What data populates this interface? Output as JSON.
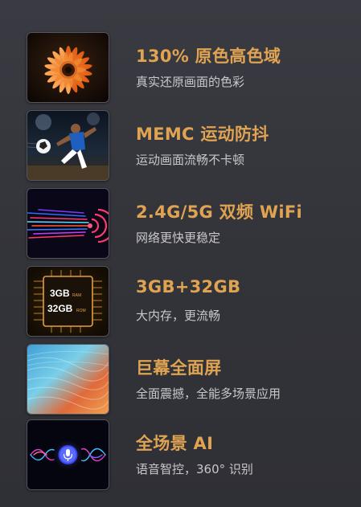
{
  "features": [
    {
      "title": "130% 原色高色域",
      "subtitle": "真实还原画面的色彩",
      "image": "orange-gerbera-flower-photo"
    },
    {
      "title": "MEMC 运动防抖",
      "subtitle": "运动画面流畅不卡顿",
      "image": "soccer-player-kicking-ball-photo"
    },
    {
      "title": "2.4G/5G 双频 WiFi",
      "subtitle": "网络更快更稳定",
      "image": "wifi-signal-light-streaks"
    },
    {
      "title": "3GB+32GB",
      "subtitle": "大内存，更流畅",
      "image": "memory-chip-icon",
      "chip_line1": "3GB",
      "chip_line1_tag": "RAM",
      "chip_line2": "32GB",
      "chip_line2_tag": "ROM"
    },
    {
      "title": "巨幕全面屏",
      "subtitle": "全面震撼，全能多场景应用",
      "image": "colorful-landscape-screen"
    },
    {
      "title": "全场景 AI",
      "subtitle": "语音智控，360° 识别",
      "image": "voice-assistant-microphone-soundwave"
    }
  ],
  "colors": {
    "title": "#e0a352",
    "subtitle": "#c8c8cc",
    "background": "#34353b"
  }
}
